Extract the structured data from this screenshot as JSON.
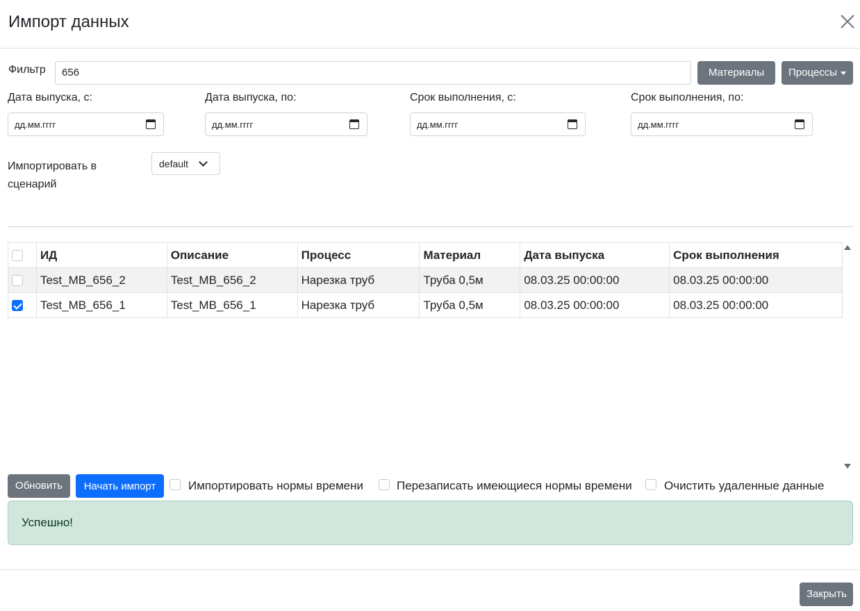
{
  "modal": {
    "title": "Импорт данных",
    "close_icon": "close-icon"
  },
  "filter": {
    "label": "Фильтр",
    "value": "656",
    "materials_button": "Материалы",
    "processes_button": "Процессы"
  },
  "dates": [
    {
      "label": "Дата выпуска, с:",
      "placeholder": "дд.мм.гггг"
    },
    {
      "label": "Дата выпуска, по:",
      "placeholder": "дд.мм.гггг"
    },
    {
      "label": "Срок выполнения, с:",
      "placeholder": "дд.мм.гггг"
    },
    {
      "label": "Срок выполнения, по:",
      "placeholder": "дд.мм.гггг"
    }
  ],
  "scenario": {
    "label_line1": "Импортировать в",
    "label_line2": "сценарий",
    "selected": "default"
  },
  "table": {
    "headers": [
      "ИД",
      "Описание",
      "Процесс",
      "Материал",
      "Дата выпуска",
      "Срок выполнения"
    ],
    "rows": [
      {
        "checked": false,
        "cells": [
          "Test_MB_656_2",
          "Test_MB_656_2",
          "Нарезка труб",
          "Труба 0,5м",
          "08.03.25 00:00:00",
          "08.03.25 00:00:00"
        ]
      },
      {
        "checked": true,
        "cells": [
          "Test_MB_656_1",
          "Test_MB_656_1",
          "Нарезка труб",
          "Труба 0,5м",
          "08.03.25 00:00:00",
          "08.03.25 00:00:00"
        ]
      }
    ]
  },
  "actions": {
    "refresh": "Обновить",
    "start_import": "Начать импорт",
    "options": [
      {
        "label": "Импортировать нормы времени",
        "checked": false
      },
      {
        "label": "Перезаписать имеющиеся нормы времени",
        "checked": false
      },
      {
        "label": "Очистить удаленные данные",
        "checked": false
      }
    ]
  },
  "alert": {
    "text": "Успешно!"
  },
  "footer": {
    "close_button": "Закрыть"
  },
  "colors": {
    "primary": "#0d6efd",
    "secondary": "#6c757d",
    "success_bg": "#d1e7dd"
  }
}
